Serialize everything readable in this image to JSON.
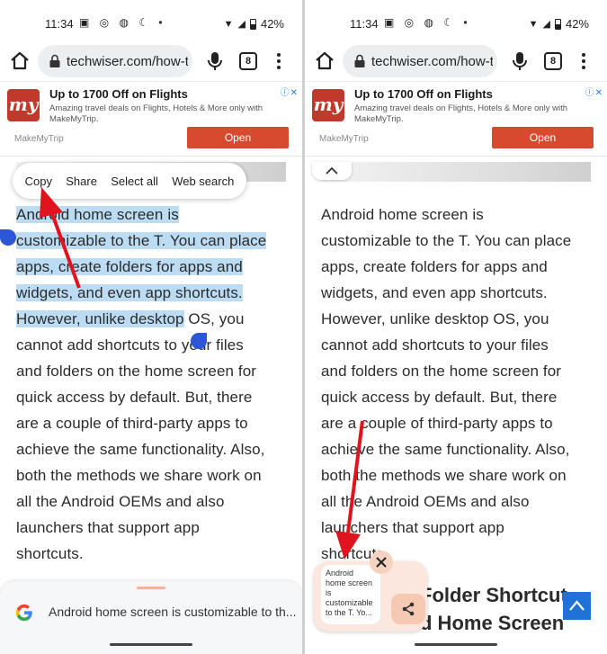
{
  "status": {
    "time": "11:34",
    "notif_icons": "▣ ◎ ◍ ☾ •",
    "battery": "42%"
  },
  "browser": {
    "url": "techwiser.com/how-to",
    "tab_count": "8"
  },
  "ad": {
    "logo_text": "my",
    "title": "Up to 1700 Off on Flights",
    "desc": "Amazing travel deals on Flights, Hotels & More only with MakeMyTrip.",
    "brand": "MakeMyTrip",
    "open_label": "Open",
    "adchoice": "ⓘ✕"
  },
  "context_menu": {
    "copy": "Copy",
    "share": "Share",
    "select_all": "Select all",
    "web_search": "Web search"
  },
  "article": {
    "lines": [
      {
        "sel": "Android home screen is",
        "rest": ""
      },
      {
        "sel": "customizable to the T. You can place",
        "rest": ""
      },
      {
        "sel": "apps, create folders for apps and",
        "rest": ""
      },
      {
        "sel": "widgets, and even app shortcuts.",
        "rest": ""
      },
      {
        "sel": "However, unlike desktop",
        "rest": " OS, you"
      },
      {
        "sel": "",
        "rest": "cannot add shortcuts to your files"
      },
      {
        "sel": "",
        "rest": "and folders on the home screen for"
      },
      {
        "sel": "",
        "rest": "quick access by default. But, there"
      },
      {
        "sel": "",
        "rest": "are a couple of third-party apps to"
      },
      {
        "sel": "",
        "rest": "achieve the same functionality. Also,"
      },
      {
        "sel": "",
        "rest": "both the methods we share work on"
      },
      {
        "sel": "",
        "rest": "all the Android OEMs and also"
      },
      {
        "sel": "",
        "rest": "launchers that support app"
      },
      {
        "sel": "",
        "rest": "shortcuts."
      }
    ]
  },
  "google_sheet": {
    "text": "Android home screen is customizable to th..."
  },
  "right": {
    "heading_line1": "Folder Shortcut",
    "heading_line2": "d Home Screen",
    "clipboard_preview": "Android home screen is customizable to the T. Yo..."
  },
  "colors": {
    "selection": "#bcdcf4",
    "handle": "#2b57d6",
    "ad_button": "#d74a30",
    "arrow": "#e0141e",
    "scroll_top": "#1f72d6"
  }
}
